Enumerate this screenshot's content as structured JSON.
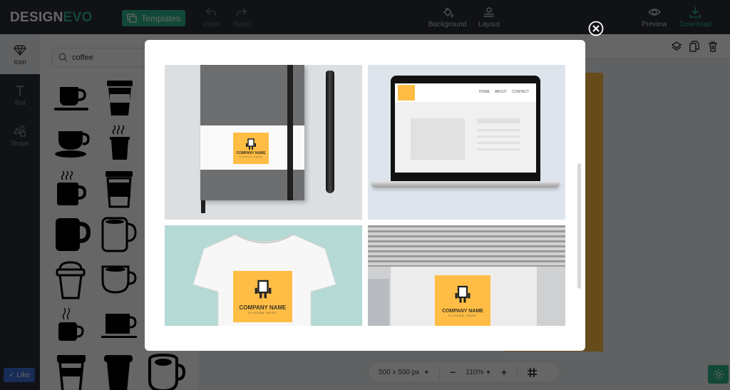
{
  "app": {
    "logo_part1": "DESIGN",
    "logo_part2": "EVO",
    "brand_color": "#2db48a",
    "accent_logo_color": "#ffbd45"
  },
  "topbar": {
    "templates_label": "Templates",
    "undo_label": "Undo",
    "redo_label": "Redo",
    "background_label": "Background",
    "layout_label": "Layout",
    "preview_label": "Preview",
    "download_label": "Download"
  },
  "leftnav": {
    "items": [
      {
        "label": "Icon",
        "icon": "diamond-icon",
        "active": true
      },
      {
        "label": "Text",
        "icon": "text-icon",
        "active": false
      },
      {
        "label": "Shape",
        "icon": "shape-icon",
        "active": false
      }
    ],
    "like_label": "Like"
  },
  "icon_panel": {
    "search_value": "coffee",
    "icons": [
      "coffee-cup-saucer-icon",
      "takeaway-cup-icon",
      "tea-cup-saucer-icon",
      "hot-takeaway-cup-icon",
      "steaming-mug-icon",
      "sleeve-takeaway-cup-icon",
      "solid-mug-icon",
      "outline-mug-icon",
      "outline-lid-cup-icon",
      "outline-cup-icon",
      "steaming-small-mug-icon",
      "square-cup-saucer-icon",
      "lid-cup-icon",
      "plain-takeaway-cup-icon",
      "outline-round-mug-icon"
    ]
  },
  "workspace": {
    "size_label": "500 x 500 px",
    "zoom_label": "110%"
  },
  "modal": {
    "mockups": [
      {
        "name": "notebook-mockup",
        "company": "COMPANY NAME",
        "slogan": "SLOGAN HERE"
      },
      {
        "name": "laptop-mockup",
        "nav": [
          "HOME",
          "ABOUT",
          "CONTACT"
        ]
      },
      {
        "name": "tshirt-mockup",
        "company": "COMPANY NAME",
        "slogan": "SLOGAN HERE"
      },
      {
        "name": "office-wall-mockup",
        "company": "COMPANY NAME",
        "slogan": "SLOGAN HERE"
      }
    ]
  }
}
